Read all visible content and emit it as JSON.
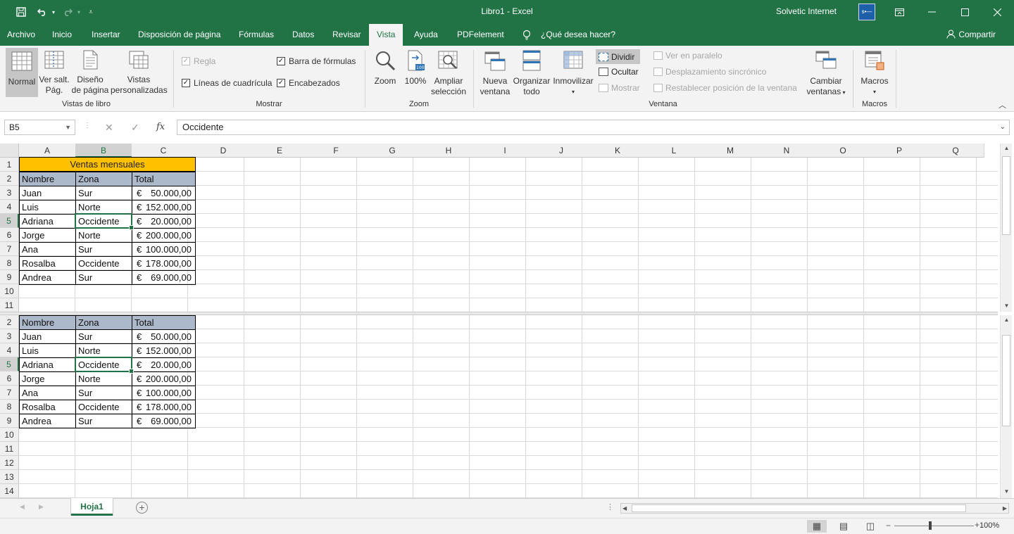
{
  "window": {
    "title": "Libro1  -  Excel",
    "user": "Solvetic Internet",
    "avatar_text": "s•—",
    "quick_access": [
      "save-icon",
      "undo-icon",
      "redo-icon",
      "customize-icon"
    ]
  },
  "tabs": [
    "Archivo",
    "Inicio",
    "Insertar",
    "Disposición de página",
    "Fórmulas",
    "Datos",
    "Revisar",
    "Vista",
    "Ayuda",
    "PDFelement",
    "¿Qué desea hacer?"
  ],
  "active_tab": "Vista",
  "share": "Compartir",
  "ribbon": {
    "vistas_libro": {
      "label": "Vistas de libro",
      "normal": "Normal",
      "ver_salt_1": "Ver salt.",
      "ver_salt_2": "Pág.",
      "diseno_1": "Diseño",
      "diseno_2": "de página",
      "vistas_1": "Vistas",
      "vistas_2": "personalizadas"
    },
    "mostrar": {
      "label": "Mostrar",
      "regla": "Regla",
      "lineas": "Líneas de cuadrícula",
      "barra": "Barra de fórmulas",
      "encabezados": "Encabezados"
    },
    "zoom": {
      "label": "Zoom",
      "zoom": "Zoom",
      "cien": "100%",
      "ampliar_1": "Ampliar",
      "ampliar_2": "selección"
    },
    "ventana": {
      "label": "Ventana",
      "nueva_1": "Nueva",
      "nueva_2": "ventana",
      "organizar_1": "Organizar",
      "organizar_2": "todo",
      "inmovilizar": "Inmovilizar",
      "dividir": "Dividir",
      "ocultar": "Ocultar",
      "mostrar": "Mostrar",
      "paralelo": "Ver en paralelo",
      "sincronico": "Desplazamiento sincrónico",
      "restablecer": "Restablecer posición de la ventana",
      "cambiar_1": "Cambiar",
      "cambiar_2": "ventanas"
    },
    "macros": {
      "label": "Macros",
      "macros": "Macros"
    }
  },
  "formula_bar": {
    "name_box": "B5",
    "content": "Occidente"
  },
  "columns": [
    "A",
    "B",
    "C",
    "D",
    "E",
    "F",
    "G",
    "H",
    "I",
    "J",
    "K",
    "L",
    "M",
    "N",
    "O",
    "P",
    "Q"
  ],
  "selected_cell": "B5",
  "table": {
    "title": "Ventas mensuales",
    "headers": [
      "Nombre",
      "Zona",
      "Total"
    ],
    "rows": [
      {
        "nombre": "Juan",
        "zona": "Sur",
        "cur": "€",
        "total": "50.000,00"
      },
      {
        "nombre": "Luis",
        "zona": "Norte",
        "cur": "€",
        "total": "152.000,00"
      },
      {
        "nombre": "Adriana",
        "zona": "Occidente",
        "cur": "€",
        "total": "20.000,00"
      },
      {
        "nombre": "Jorge",
        "zona": "Norte",
        "cur": "€",
        "total": "200.000,00"
      },
      {
        "nombre": "Ana",
        "zona": "Sur",
        "cur": "€",
        "total": "100.000,00"
      },
      {
        "nombre": "Rosalba",
        "zona": "Occidente",
        "cur": "€",
        "total": "178.000,00"
      },
      {
        "nombre": "Andrea",
        "zona": "Sur",
        "cur": "€",
        "total": "69.000,00"
      }
    ]
  },
  "top_pane_rows": [
    "1",
    "2",
    "3",
    "4",
    "5",
    "6",
    "7",
    "8",
    "9",
    "10",
    "11"
  ],
  "bottom_pane_rows": [
    "2",
    "3",
    "4",
    "5",
    "6",
    "7",
    "8",
    "9",
    "10",
    "11",
    "12",
    "13",
    "14"
  ],
  "sheet_tab": "Hoja1",
  "status": {
    "zoom": "100%"
  },
  "colors": {
    "brand": "#217346",
    "header_fill": "#acb9ca",
    "title_fill": "#ffc000"
  }
}
